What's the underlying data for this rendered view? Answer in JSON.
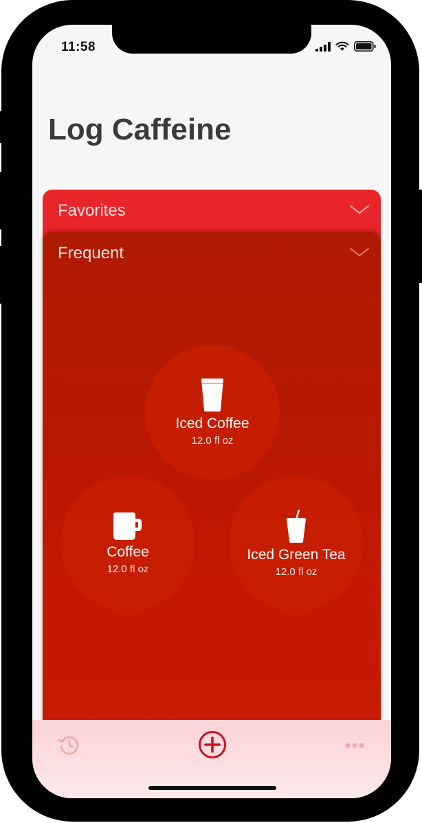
{
  "status_bar": {
    "time": "11:58"
  },
  "header": {
    "title": "Log Caffeine"
  },
  "sections": {
    "favorites": {
      "label": "Favorites"
    },
    "frequent": {
      "label": "Frequent"
    }
  },
  "drinks": [
    {
      "name": "Iced Coffee",
      "volume": "12.0 fl oz",
      "icon": "cup-icon"
    },
    {
      "name": "Coffee",
      "volume": "12.0 fl oz",
      "icon": "mug-icon"
    },
    {
      "name": "Iced Green Tea",
      "volume": "12.0 fl oz",
      "icon": "straw-cup-icon"
    }
  ],
  "tab_bar": {
    "items": [
      "history-icon",
      "add-circle-icon",
      "more-icon"
    ],
    "accent_color": "#c8141e",
    "muted_color": "#f3a4a8"
  },
  "colors": {
    "favorites_card": "#e8252a",
    "frequent_card": "#c21a02"
  }
}
